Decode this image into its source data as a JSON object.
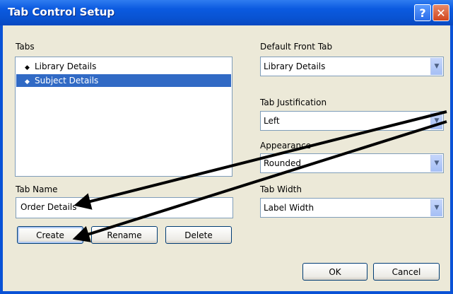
{
  "window": {
    "title": "Tab Control Setup",
    "help_label": "?",
    "close_label": "✕"
  },
  "tabs_panel": {
    "label": "Tabs",
    "items": [
      {
        "label": "Library Details",
        "selected": false
      },
      {
        "label": "Subject Details",
        "selected": true
      }
    ]
  },
  "tab_name": {
    "label": "Tab Name",
    "value": "Order Details"
  },
  "buttons": {
    "create": "Create",
    "rename": "Rename",
    "delete": "Delete",
    "ok": "OK",
    "cancel": "Cancel"
  },
  "default_front_tab": {
    "label": "Default Front Tab",
    "value": "Library Details"
  },
  "tab_justification": {
    "label": "Tab Justification",
    "value": "Left"
  },
  "appearance": {
    "label": "Appearance",
    "value": "Rounded"
  },
  "tab_width": {
    "label": "Tab Width",
    "value": "Label Width"
  },
  "colors": {
    "titlebar": "#0953d2",
    "selection": "#316ac5",
    "dialog_bg": "#ece9d8",
    "annotation_arrow": "#000000"
  },
  "icons": {
    "list_bullet": "diamond-bullet-icon",
    "dropdown": "chevron-down-icon",
    "help": "help-icon",
    "close": "close-icon"
  }
}
